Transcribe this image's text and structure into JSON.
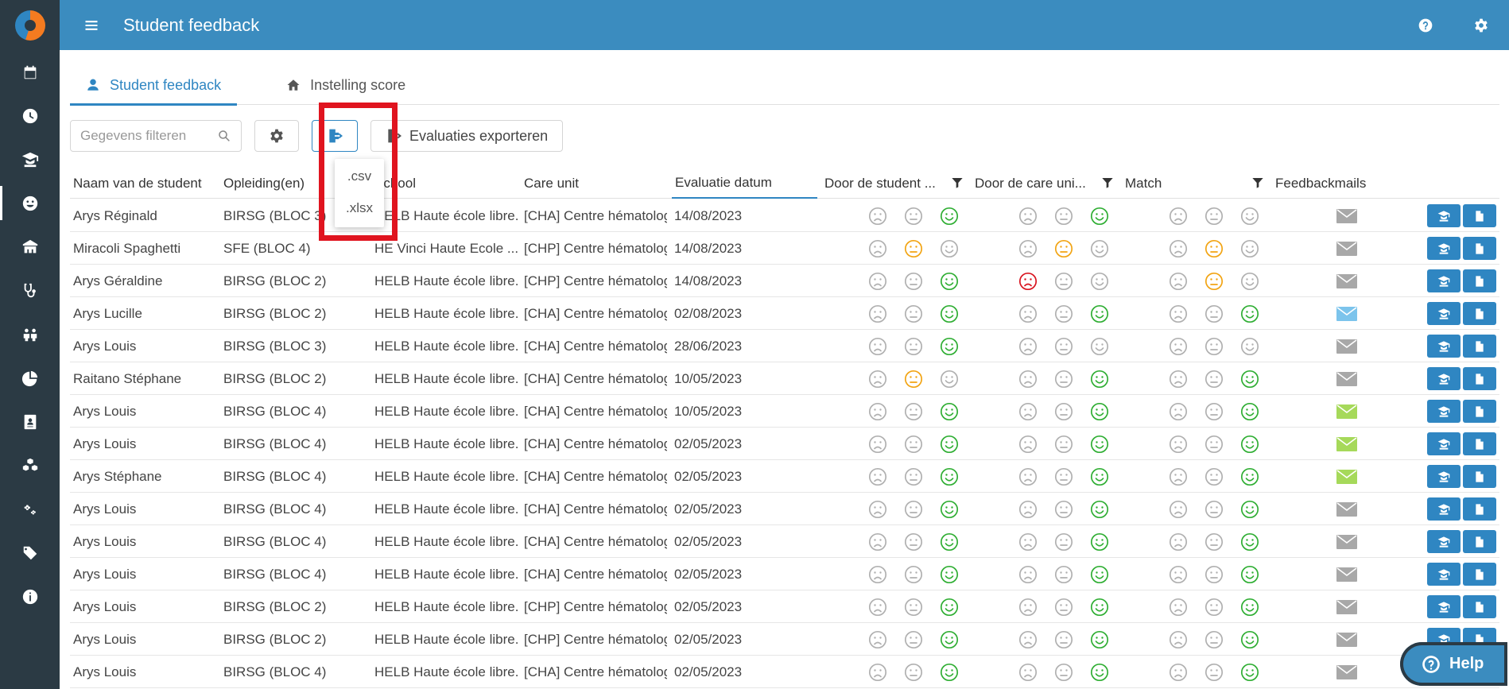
{
  "header": {
    "title": "Student feedback"
  },
  "tabs": [
    {
      "label": "Student feedback",
      "active": true
    },
    {
      "label": "Instelling score",
      "active": false
    }
  ],
  "toolbar": {
    "search_placeholder": "Gegevens filteren",
    "export_label": "Evaluaties exporteren"
  },
  "export_menu": {
    "items": [
      ".csv",
      ".xlsx"
    ]
  },
  "columns": {
    "student": "Naam van de student",
    "opleiding": "Opleiding(en)",
    "school": "School",
    "care_unit": "Care unit",
    "datum": "Evaluatie datum",
    "door_student": "Door de student ...",
    "door_care": "Door de care uni...",
    "match": "Match",
    "feedbackmails": "Feedbackmails"
  },
  "colors": {
    "sad": "#d9141f",
    "neutral": "#f2a413",
    "happy": "#2fae33",
    "inactive": "#b0b0b0",
    "mail_grey": "#a8a8a8",
    "mail_blue": "#7cc4ec",
    "mail_green": "#a6d95a",
    "primary": "#2f86c2",
    "sidebar": "#2b3a44"
  },
  "rows": [
    {
      "name": "Arys Réginald",
      "opleiding": "BIRSG (BLOC 3)",
      "school": "HELB Haute école libre...",
      "care": "[CHA] Centre hématologie...",
      "date": "14/08/2023",
      "student": "happy",
      "care_score": "happy",
      "match": "none",
      "mail": "grey"
    },
    {
      "name": "Miracoli Spaghetti",
      "opleiding": "SFE (BLOC 4)",
      "school": "HE Vinci Haute Ecole ...",
      "care": "[CHP] Centre hématologie...",
      "date": "14/08/2023",
      "student": "neutral",
      "care_score": "neutral",
      "match": "neutral",
      "mail": "grey"
    },
    {
      "name": "Arys Géraldine",
      "opleiding": "BIRSG (BLOC 2)",
      "school": "HELB Haute école libre...",
      "care": "[CHP] Centre hématologie...",
      "date": "14/08/2023",
      "student": "happy",
      "care_score": "sad",
      "match": "neutral",
      "mail": "grey"
    },
    {
      "name": "Arys Lucille",
      "opleiding": "BIRSG (BLOC 2)",
      "school": "HELB Haute école libre...",
      "care": "[CHA] Centre hématologie...",
      "date": "02/08/2023",
      "student": "happy",
      "care_score": "happy",
      "match": "happy",
      "mail": "blue"
    },
    {
      "name": "Arys Louis",
      "opleiding": "BIRSG (BLOC 3)",
      "school": "HELB Haute école libre...",
      "care": "[CHA] Centre hématologie...",
      "date": "28/06/2023",
      "student": "happy",
      "care_score": "none",
      "match": "none",
      "mail": "grey"
    },
    {
      "name": "Raitano Stéphane",
      "opleiding": "BIRSG (BLOC 2)",
      "school": "HELB Haute école libre...",
      "care": "[CHA] Centre hématologie...",
      "date": "10/05/2023",
      "student": "neutral",
      "care_score": "happy",
      "match": "happy",
      "mail": "grey"
    },
    {
      "name": "Arys Louis",
      "opleiding": "BIRSG (BLOC 4)",
      "school": "HELB Haute école libre...",
      "care": "[CHA] Centre hématologie...",
      "date": "10/05/2023",
      "student": "happy",
      "care_score": "happy",
      "match": "happy",
      "mail": "green"
    },
    {
      "name": "Arys Louis",
      "opleiding": "BIRSG (BLOC 4)",
      "school": "HELB Haute école libre...",
      "care": "[CHA] Centre hématologie...",
      "date": "02/05/2023",
      "student": "happy",
      "care_score": "happy",
      "match": "happy",
      "mail": "green"
    },
    {
      "name": "Arys Stéphane",
      "opleiding": "BIRSG (BLOC 4)",
      "school": "HELB Haute école libre...",
      "care": "[CHA] Centre hématologie...",
      "date": "02/05/2023",
      "student": "happy",
      "care_score": "happy",
      "match": "happy",
      "mail": "green"
    },
    {
      "name": "Arys Louis",
      "opleiding": "BIRSG (BLOC 4)",
      "school": "HELB Haute école libre...",
      "care": "[CHA] Centre hématologie...",
      "date": "02/05/2023",
      "student": "happy",
      "care_score": "happy",
      "match": "happy",
      "mail": "grey"
    },
    {
      "name": "Arys Louis",
      "opleiding": "BIRSG (BLOC 4)",
      "school": "HELB Haute école libre...",
      "care": "[CHA] Centre hématologie...",
      "date": "02/05/2023",
      "student": "happy",
      "care_score": "happy",
      "match": "happy",
      "mail": "grey"
    },
    {
      "name": "Arys Louis",
      "opleiding": "BIRSG (BLOC 4)",
      "school": "HELB Haute école libre...",
      "care": "[CHA] Centre hématologie...",
      "date": "02/05/2023",
      "student": "happy",
      "care_score": "happy",
      "match": "happy",
      "mail": "grey"
    },
    {
      "name": "Arys Louis",
      "opleiding": "BIRSG (BLOC 2)",
      "school": "HELB Haute école libre...",
      "care": "[CHP] Centre hématologie...",
      "date": "02/05/2023",
      "student": "happy",
      "care_score": "happy",
      "match": "happy",
      "mail": "grey"
    },
    {
      "name": "Arys Louis",
      "opleiding": "BIRSG (BLOC 2)",
      "school": "HELB Haute école libre...",
      "care": "[CHP] Centre hématologie...",
      "date": "02/05/2023",
      "student": "happy",
      "care_score": "happy",
      "match": "happy",
      "mail": "grey"
    },
    {
      "name": "Arys Louis",
      "opleiding": "BIRSG (BLOC 4)",
      "school": "HELB Haute école libre...",
      "care": "[CHA] Centre hématologie...",
      "date": "02/05/2023",
      "student": "happy",
      "care_score": "happy",
      "match": "happy",
      "mail": "grey"
    }
  ],
  "help": {
    "label": "Help"
  }
}
